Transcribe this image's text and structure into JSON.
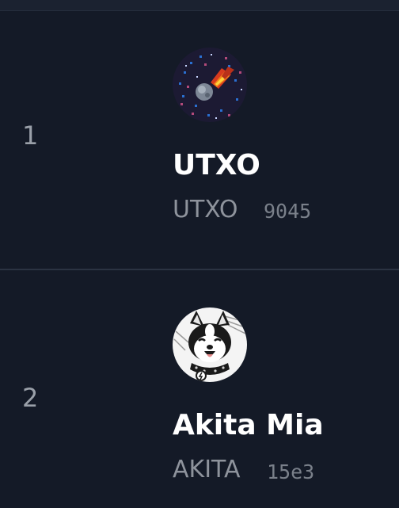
{
  "list": {
    "items": [
      {
        "rank": "1",
        "avatar_icon": "comet-pixel-art-icon",
        "name": "UTXO",
        "ticker": "UTXO",
        "number": "9045"
      },
      {
        "rank": "2",
        "avatar_icon": "akita-dog-cartoon-icon",
        "name": "Akita Mia",
        "ticker": "AKITA",
        "number": "15e3"
      }
    ]
  },
  "colors": {
    "background": "#141a27",
    "divider": "#2b3342",
    "name": "#ffffff",
    "ticker": "#8e939c",
    "rank": "#9aa0a9"
  }
}
